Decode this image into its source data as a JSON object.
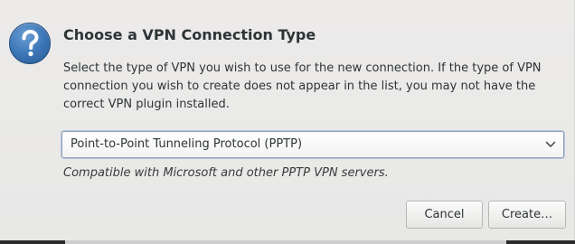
{
  "dialog": {
    "icon": "question-icon",
    "title": "Choose a VPN Connection Type",
    "description": "Select the type of VPN you wish to use for the new connection.  If the type of VPN connection you wish to create does not appear in the list, you may not have the correct VPN plugin installed.",
    "vpn_type_select": {
      "selected": "Point-to-Point Tunneling Protocol (PPTP)"
    },
    "hint": "Compatible with Microsoft and other PPTP VPN servers.",
    "buttons": {
      "cancel": "Cancel",
      "create": "Create…"
    }
  },
  "colors": {
    "dialog_bg": "#e8e8e7",
    "icon_blue": "#3a73b5",
    "text": "#2e3436",
    "focus_border": "#8fa0b6"
  }
}
